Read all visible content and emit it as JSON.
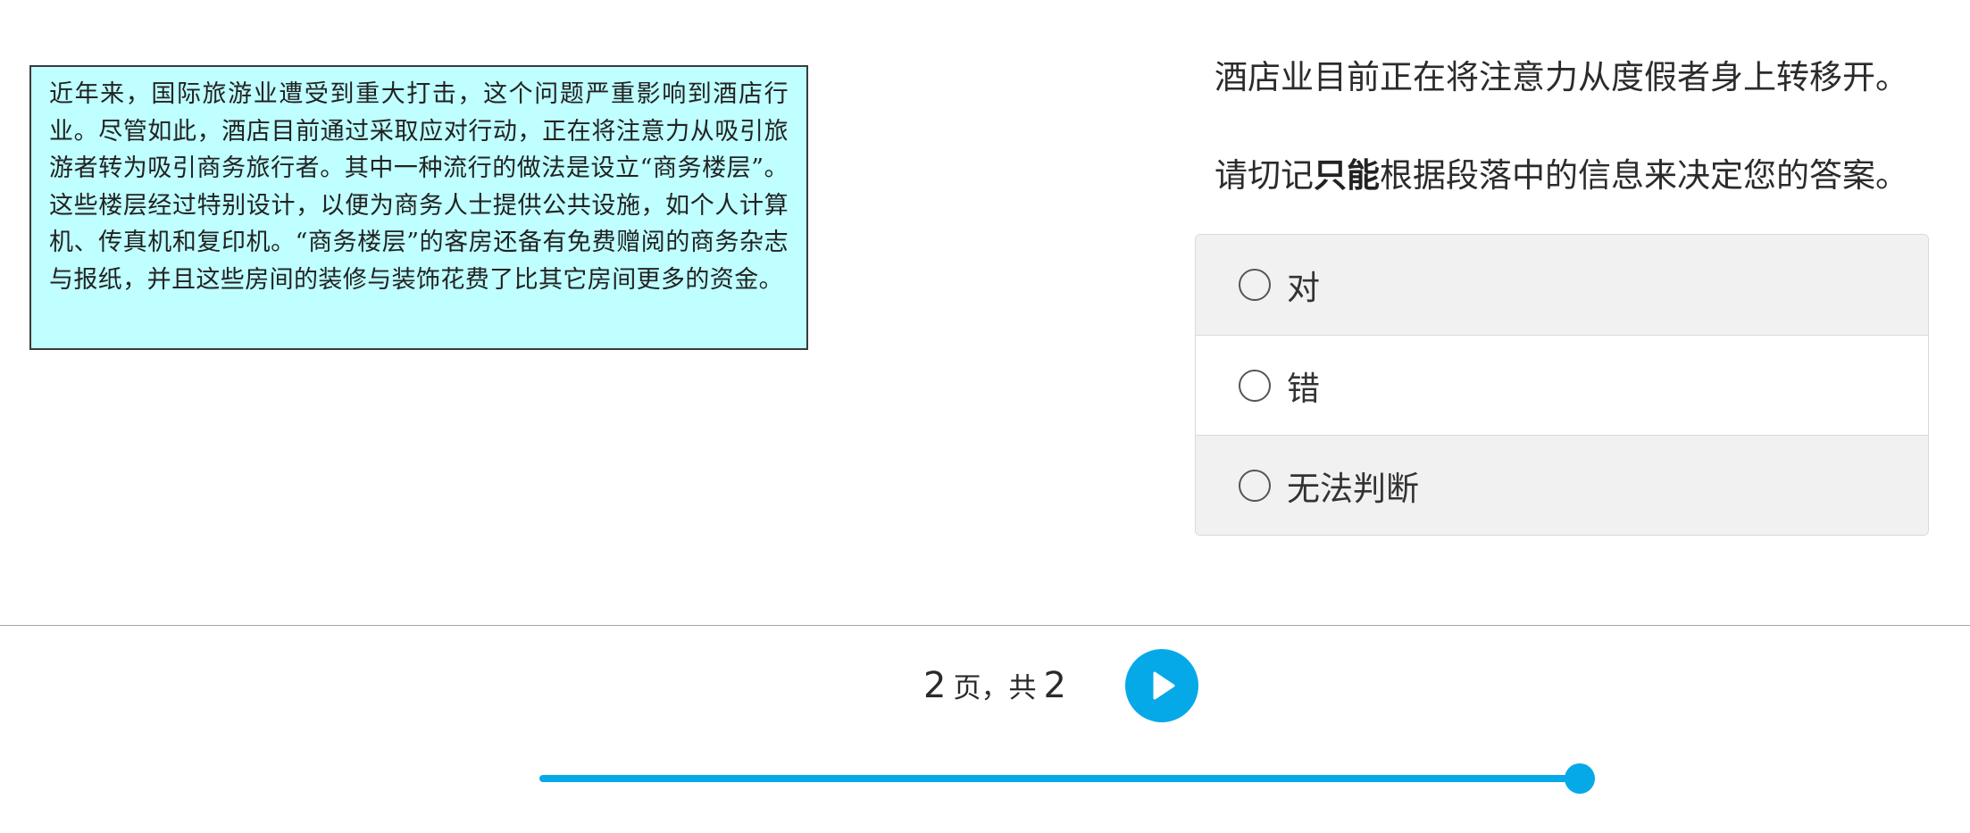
{
  "passage": {
    "text": "近年来，国际旅游业遭受到重大打击，这个问题严重影响到酒店行业。尽管如此，酒店目前通过采取应对行动，正在将注意力从吸引旅游者转为吸引商务旅行者。其中一种流行的做法是设立“商务楼层”。这些楼层经过特别设计，以便为商务人士提供公共设施，如个人计算机、传真机和复印机。“商务楼层”的客房还备有免费赠阅的商务杂志与报纸，并且这些房间的装修与装饰花费了比其它房间更多的资金。"
  },
  "question": {
    "statement": "酒店业目前正在将注意力从度假者身上转移开。",
    "instruction_before": "请切记",
    "instruction_bold": "只能",
    "instruction_after": "根据段落中的信息来决定您的答案。"
  },
  "options": [
    {
      "label": "对",
      "selected": false
    },
    {
      "label": "错",
      "selected": false
    },
    {
      "label": "无法判断",
      "selected": false
    }
  ],
  "footer": {
    "current_page": "2",
    "page_word": "页，共",
    "total_pages": "2",
    "play_icon": "play-icon",
    "progress_fraction": 1.0
  },
  "colors": {
    "accent": "#06a9e8",
    "passage_bg": "#bfffff",
    "option_shaded": "#f1f1f1"
  }
}
